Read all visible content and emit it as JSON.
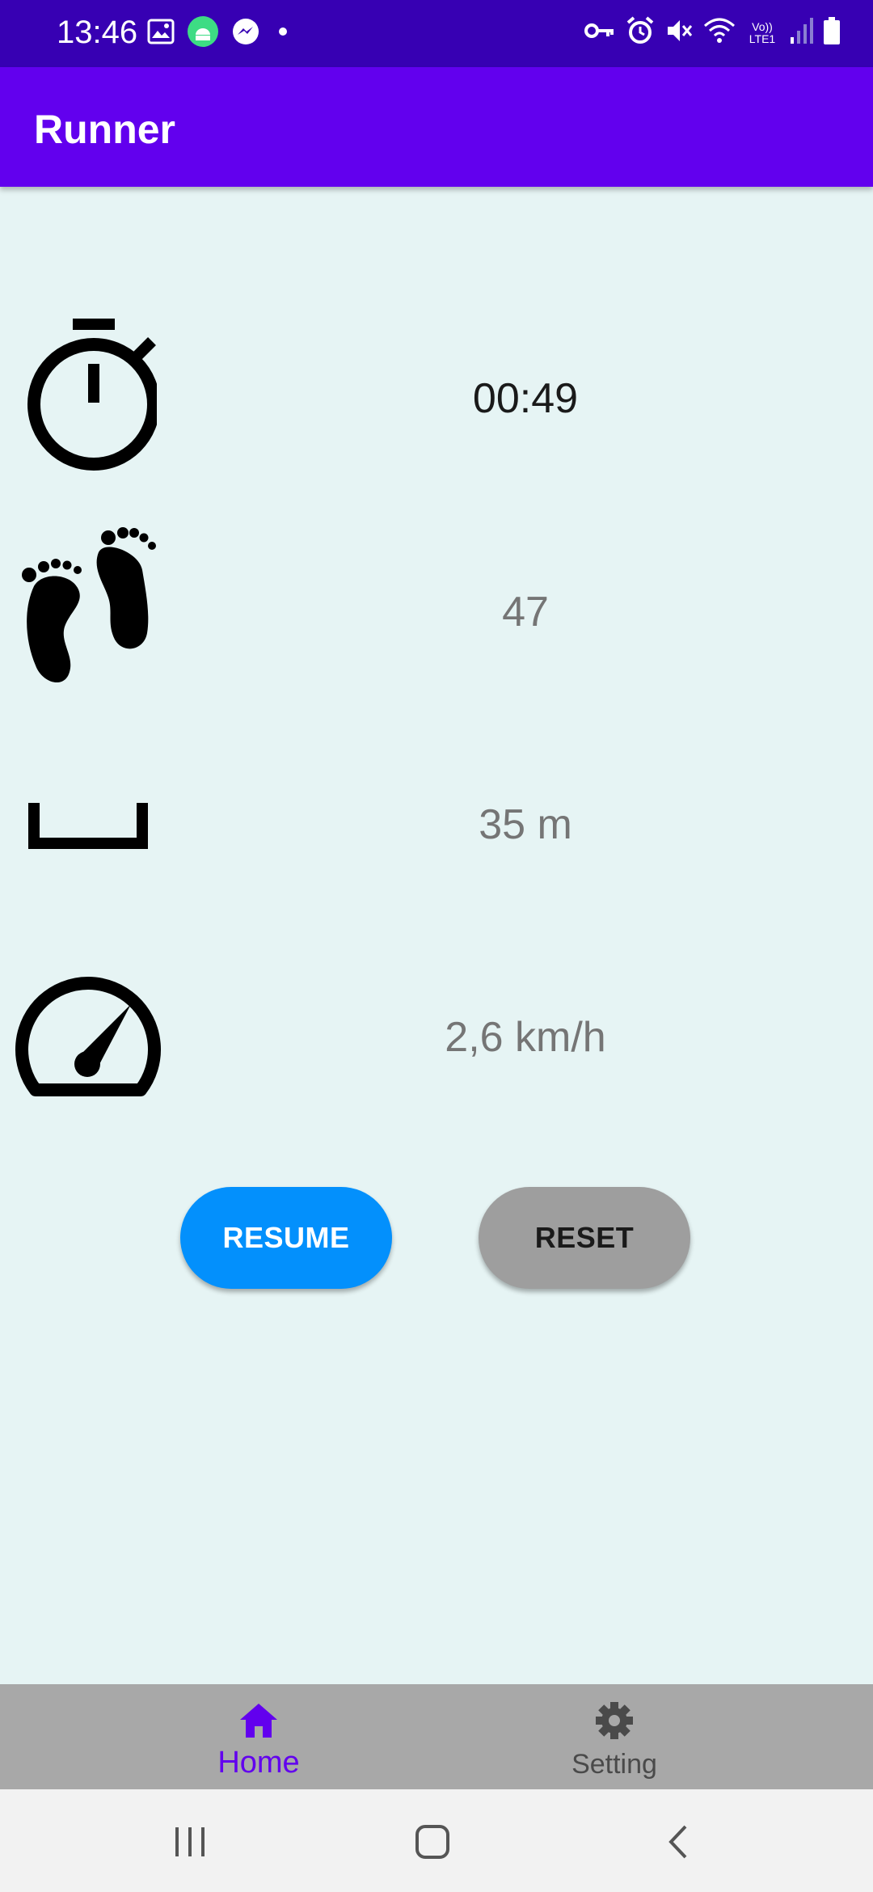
{
  "status_bar": {
    "time": "13:46",
    "left_icons": [
      "image-icon",
      "android-icon",
      "messenger-icon",
      "dot-icon"
    ],
    "right_icons": [
      "key-icon",
      "alarm-icon",
      "mute-icon",
      "wifi-icon",
      "volte-icon",
      "signal-icon",
      "battery-icon"
    ],
    "volte_label": "Vo)) LTE1"
  },
  "app_bar": {
    "title": "Runner"
  },
  "metrics": {
    "time": {
      "icon": "stopwatch-icon",
      "value": "00:49"
    },
    "steps": {
      "icon": "footprints-icon",
      "value": "47"
    },
    "distance": {
      "icon": "distance-icon",
      "value": "35 m"
    },
    "speed": {
      "icon": "speedometer-icon",
      "value": "2,6  km/h"
    }
  },
  "buttons": {
    "resume_label": "RESUME",
    "reset_label": "RESET"
  },
  "bottom_nav": {
    "items": [
      {
        "label": "Home",
        "icon": "home-icon",
        "active": true
      },
      {
        "label": "Setting",
        "icon": "gear-icon",
        "active": false
      }
    ]
  },
  "colors": {
    "status_bar": "#3700b3",
    "app_bar": "#6200ee",
    "background": "#e6f4f4",
    "resume_button": "#0390fc",
    "reset_button": "#9e9e9e",
    "bottom_nav": "#a8a8a8",
    "active_nav": "#6200ee"
  }
}
